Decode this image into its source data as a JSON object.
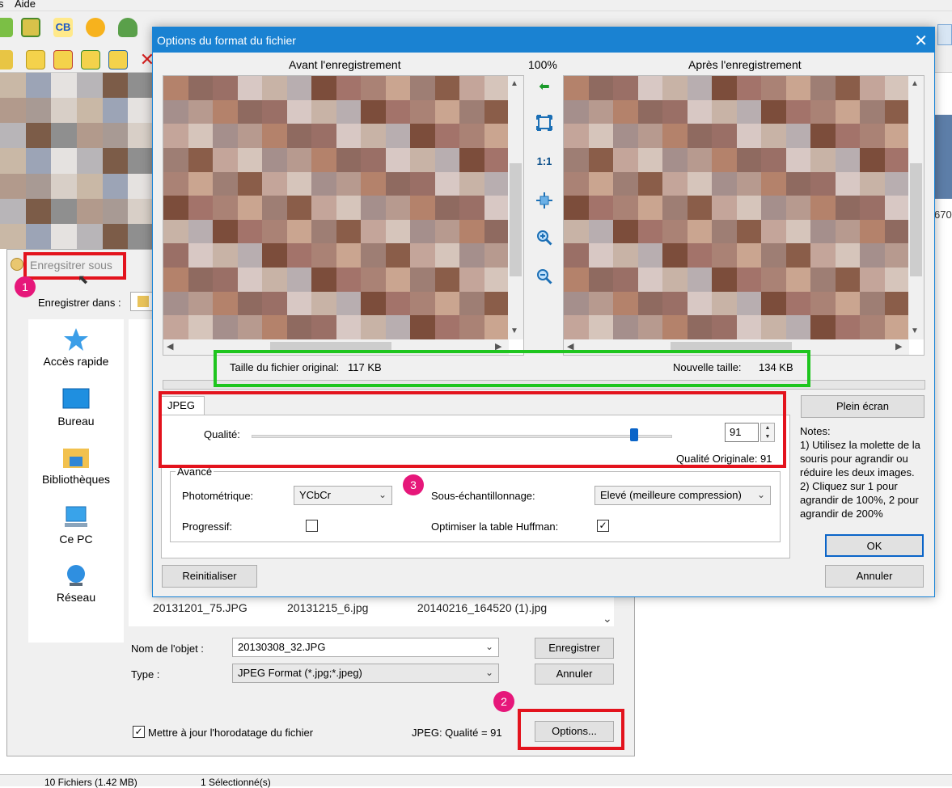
{
  "app": {
    "menu_aide": "Aide",
    "statusbar": {
      "files": "10 Fichiers (1.42 MB)",
      "selected": "1 Sélectionné(s)"
    },
    "right_strip_number": "670"
  },
  "save_dialog": {
    "title": "Enregsitrer sous",
    "location_label": "Enregistrer dans :",
    "places": [
      "Accès rapide",
      "Bureau",
      "Bibliothèques",
      "Ce PC",
      "Réseau"
    ],
    "files": [
      "20131201_75.JPG",
      "20131215_6.jpg",
      "20140216_164520 (1).jpg"
    ],
    "name_label": "Nom de l'objet :",
    "name_value": "20130308_32.JPG",
    "type_label": "Type :",
    "type_value": "JPEG Format (*.jpg;*.jpeg)",
    "save_button": "Enregistrer",
    "cancel_button": "Annuler",
    "timestamp_checkbox_label": "Mettre à jour l'horodatage du fichier",
    "jpeg_quality_text": "JPEG: Qualité = 91",
    "options_button": "Options..."
  },
  "options_dialog": {
    "title": "Options du format du fichier",
    "close_glyph": "✕",
    "before_title": "Avant l'enregistrement",
    "zoom_level": "100%",
    "after_title": "Après l'enregistrement",
    "tools": {
      "one_to_one": "1:1"
    },
    "original_size_label": "Taille du fichier original:",
    "original_size_value": "117 KB",
    "new_size_label": "Nouvelle taille:",
    "new_size_value": "134 KB",
    "fullscreen_button": "Plein écran",
    "tab_jpeg": "JPEG",
    "quality_label": "Qualité:",
    "quality_value": "91",
    "quality_fraction": 0.91,
    "original_quality": "Qualité Originale: 91",
    "advanced_legend": "Avancé",
    "photometric_label": "Photométrique:",
    "photometric_value": "YCbCr",
    "progressive_label": "Progressif:",
    "subsampling_label": "Sous-échantillonnage:",
    "subsampling_value": "Elevé (meilleure compression)",
    "huffman_label": "Optimiser la table Huffman:",
    "huffman_check": "✓",
    "notes_title": "Notes:",
    "notes": [
      "1) Utilisez la molette de la souris pour agrandir ou réduire les deux images.",
      "2) Cliquez sur 1 pour agrandir de 100%, 2 pour agrandir de 200%"
    ],
    "ok_button": "OK",
    "cancel_button": "Annuler",
    "reset_button": "Reinitialiser"
  },
  "annotations": {
    "badge_1": "1",
    "badge_2": "2",
    "badge_3": "3"
  },
  "colors": {
    "titlebar": "#1a82d2",
    "annotation_red": "#e3131d",
    "annotation_green": "#1ec51e",
    "badge_pink": "#e6177a",
    "slider_thumb": "#0a64c8"
  }
}
